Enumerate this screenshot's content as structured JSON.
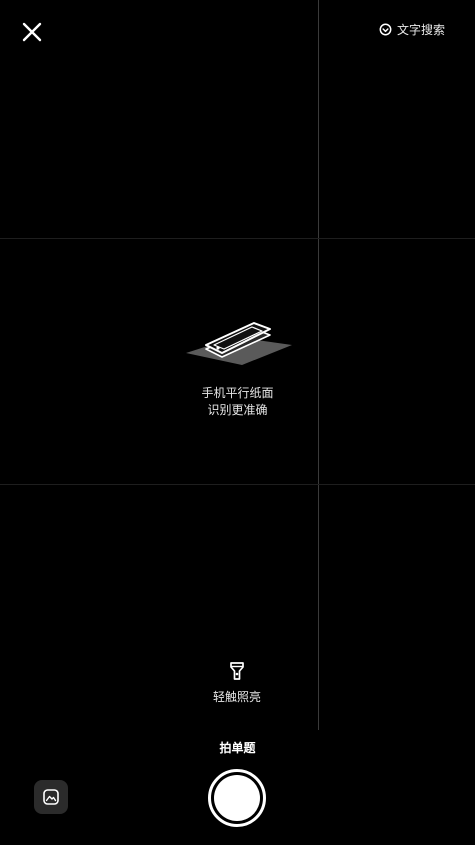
{
  "top_bar": {
    "close_icon": "close-icon",
    "text_search_icon": "search-text-icon",
    "text_search_label": "文字搜索"
  },
  "hint": {
    "illustration": "phone-parallel-paper-illustration",
    "line1": "手机平行纸面",
    "line2": "识别更准确"
  },
  "flashlight": {
    "icon": "flashlight-icon",
    "label": "轻触照亮"
  },
  "mode": {
    "label": "拍单题"
  },
  "bottom": {
    "gallery_icon": "gallery-icon",
    "shutter": "shutter-button"
  }
}
